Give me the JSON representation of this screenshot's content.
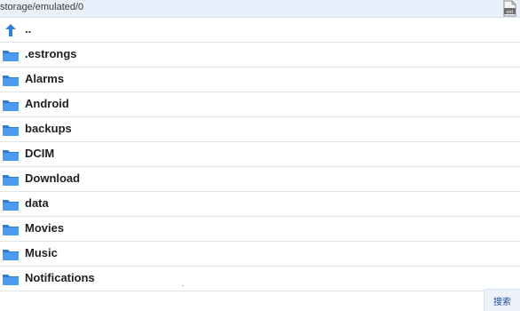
{
  "path_bar": {
    "path": "storage/emulated/0",
    "filetype_icon": "ext-file-icon",
    "filetype_label": "ext"
  },
  "list": {
    "parent": {
      "label": "..",
      "icon": "up-arrow-icon"
    },
    "folders": [
      {
        "label": ".estrongs",
        "icon": "folder-icon"
      },
      {
        "label": "Alarms",
        "icon": "folder-icon"
      },
      {
        "label": "Android",
        "icon": "folder-icon"
      },
      {
        "label": "backups",
        "icon": "folder-icon"
      },
      {
        "label": "DCIM",
        "icon": "folder-icon"
      },
      {
        "label": "Download",
        "icon": "folder-icon"
      },
      {
        "label": "data",
        "icon": "folder-icon"
      },
      {
        "label": "Movies",
        "icon": "folder-icon"
      },
      {
        "label": "Music",
        "icon": "folder-icon"
      },
      {
        "label": "Notifications",
        "icon": "folder-icon"
      }
    ]
  },
  "footer": {
    "search_label": "搜索"
  },
  "colors": {
    "folder_blue": "#3f8fe6",
    "pathbar_bg": "#e9f0fb",
    "accent": "#1d4f91"
  }
}
